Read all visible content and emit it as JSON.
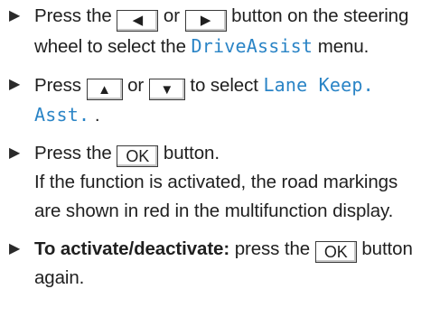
{
  "steps": [
    {
      "arrow": "▶",
      "text1": "Press the",
      "key1_icon": "◀",
      "text2": "or",
      "key2_icon": "▶",
      "text3": "button on the steering wheel to select the",
      "menu": "DriveAssist",
      "text4": "menu."
    },
    {
      "arrow": "▶",
      "text1": "Press",
      "key1_icon": "▲",
      "text2": "or",
      "key2_icon": "▼",
      "text3": "to select",
      "menu": "Lane Keep. Asst.",
      "text4": "."
    },
    {
      "arrow": "▶",
      "text1": "Press the",
      "key1": "OK",
      "text2": "button.",
      "text3": "If the function is activated, the road markings are shown in red in the multifunction display."
    },
    {
      "arrow": "▶",
      "bold": "To activate/deactivate:",
      "text1": "press the",
      "key1": "OK",
      "text2": "button again."
    }
  ],
  "icons": {
    "arrow": "right-triangle-icon",
    "left": "left-triangle-icon",
    "right": "right-triangle-icon",
    "up": "up-triangle-icon",
    "down": "down-triangle-icon"
  },
  "colors": {
    "text": "#1f1f1f",
    "accent": "#2a84c6",
    "border": "#3a3a3a"
  }
}
